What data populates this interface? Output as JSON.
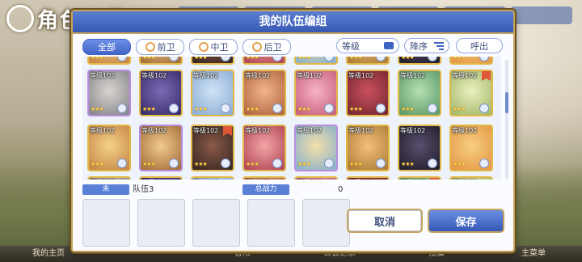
{
  "background": {
    "title": "角色一览",
    "bottom_nav": [
      "我的主页",
      "",
      "冒险",
      "公会之家",
      "扭蛋",
      "主菜单"
    ]
  },
  "dialog": {
    "title": "我的队伍编组",
    "tabs": [
      {
        "label": "全部",
        "active": true
      },
      {
        "label": "前卫",
        "active": false
      },
      {
        "label": "中卫",
        "active": false
      },
      {
        "label": "后卫",
        "active": false
      }
    ],
    "sort_level_label": "等级",
    "sort_order_label": "降序",
    "call_label": "呼出",
    "level_label": "等级102",
    "stars": "★★★",
    "team": {
      "index_label": "未",
      "name": "队伍3",
      "power_label": "总战力",
      "power_value": "0"
    },
    "cancel_label": "取消",
    "save_label": "保存"
  },
  "colors": {
    "accent": "#3f63c3",
    "frame_gold": "#c6a45d",
    "title_bar": "#4c6fc6"
  }
}
